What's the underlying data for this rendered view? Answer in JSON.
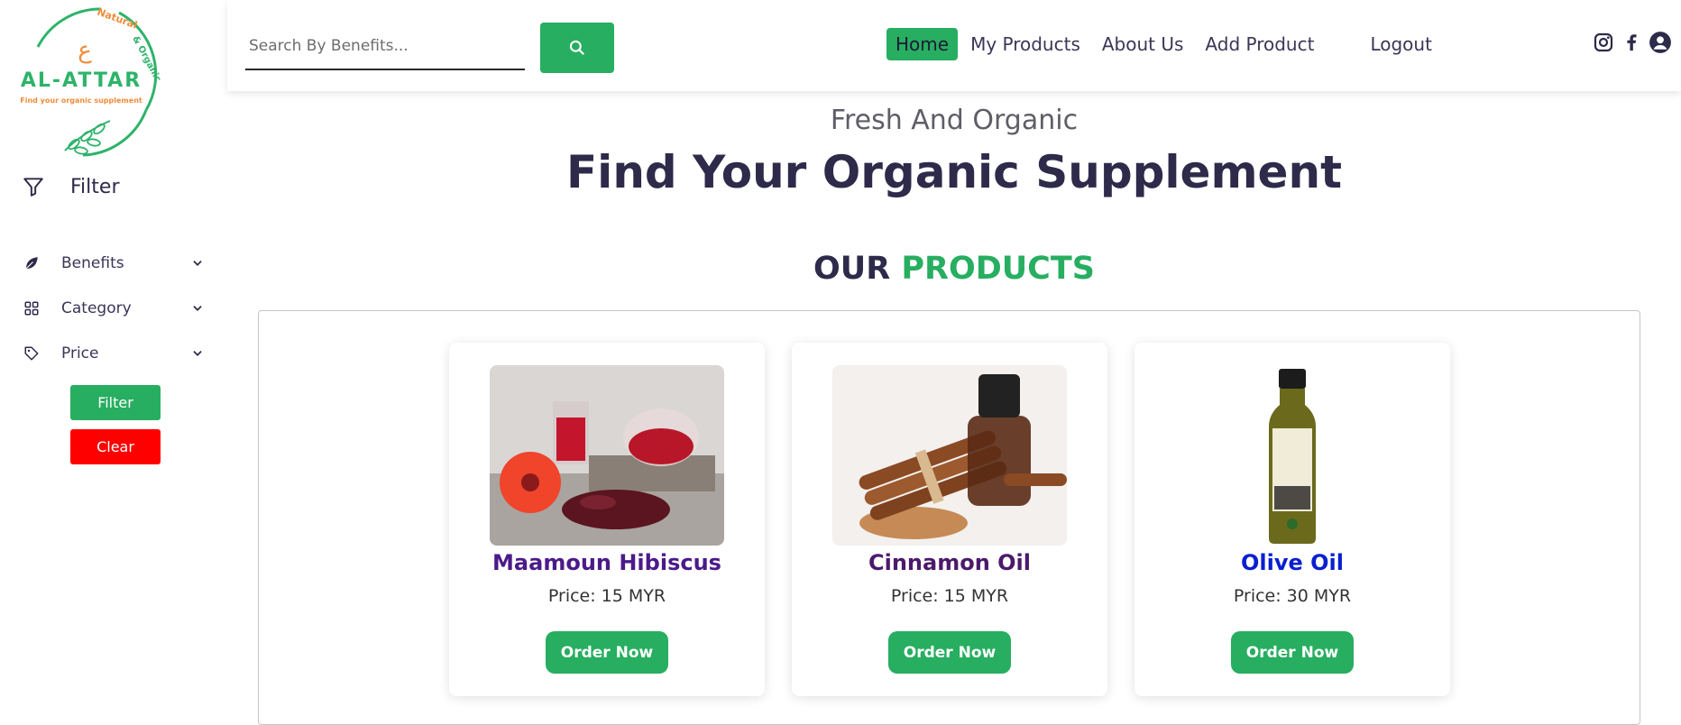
{
  "logo": {
    "brand": "AL-ATTAR",
    "tagline": "Find your organic supplement",
    "arc_text": "Natural & Organic"
  },
  "sidebar": {
    "filter_heading": "Filter",
    "items": [
      {
        "label": "Benefits",
        "icon": "leaf-icon"
      },
      {
        "label": "Category",
        "icon": "grid-icon"
      },
      {
        "label": "Price",
        "icon": "tag-icon"
      }
    ],
    "filter_button": "Filter",
    "clear_button": "Clear"
  },
  "header": {
    "search_placeholder": "Search By Benefits...",
    "nav": [
      {
        "label": "Home",
        "active": true
      },
      {
        "label": "My Products"
      },
      {
        "label": "About Us"
      },
      {
        "label": "Add Product"
      },
      {
        "label": "Logout"
      }
    ],
    "social": [
      "instagram-icon",
      "facebook-icon",
      "user-account-icon"
    ]
  },
  "hero": {
    "subtitle": "Fresh And Organic",
    "title": "Find Your Organic Supplement"
  },
  "section": {
    "title_dark": "OUR",
    "title_green": "PRODUCTS"
  },
  "products": [
    {
      "name": "Maamoun Hibiscus",
      "price": "Price: 15 MYR",
      "button": "Order Now",
      "name_color": "#4b1a8a"
    },
    {
      "name": "Cinnamon Oil",
      "price": "Price: 15 MYR",
      "button": "Order Now",
      "name_color": "#4b1a6a"
    },
    {
      "name": "Olive Oil",
      "price": "Price: 30 MYR",
      "button": "Order Now",
      "name_color": "#0a1fd0"
    }
  ],
  "colors": {
    "accent": "#27ae60",
    "danger": "#ff0000",
    "navy": "#2d2a4a"
  }
}
